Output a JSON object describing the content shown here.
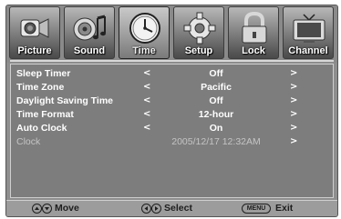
{
  "tabs": [
    {
      "label": "Picture",
      "icon": "camera-icon"
    },
    {
      "label": "Sound",
      "icon": "speaker-music-icon"
    },
    {
      "label": "Time",
      "icon": "clock-icon",
      "active": true
    },
    {
      "label": "Setup",
      "icon": "gear-icon"
    },
    {
      "label": "Lock",
      "icon": "padlock-icon"
    },
    {
      "label": "Channel",
      "icon": "tv-icon"
    }
  ],
  "settings": [
    {
      "name": "Sleep Timer",
      "value": "Off",
      "left_arrow": "<",
      "right_arrow": ">"
    },
    {
      "name": "Time Zone",
      "value": "Pacific",
      "left_arrow": "<",
      "right_arrow": ">"
    },
    {
      "name": "Daylight Saving Time",
      "value": "Off",
      "left_arrow": "<",
      "right_arrow": ">"
    },
    {
      "name": "Time Format",
      "value": "12-hour",
      "left_arrow": "<",
      "right_arrow": ">"
    },
    {
      "name": "Auto Clock",
      "value": "On",
      "left_arrow": "<",
      "right_arrow": ">"
    },
    {
      "name": "Clock",
      "value": "2005/12/17 12:32AM",
      "right_arrow": ">",
      "disabled": true
    }
  ],
  "footer": {
    "move_label": "Move",
    "select_label": "Select",
    "menu_badge": "MENU",
    "exit_label": "Exit"
  },
  "colors": {
    "background": "#8e8e8e",
    "panel": "#7d7d7d",
    "text": "#ffffff",
    "disabled_text": "#c4c4c4",
    "footer_text": "#1e1e1e"
  }
}
